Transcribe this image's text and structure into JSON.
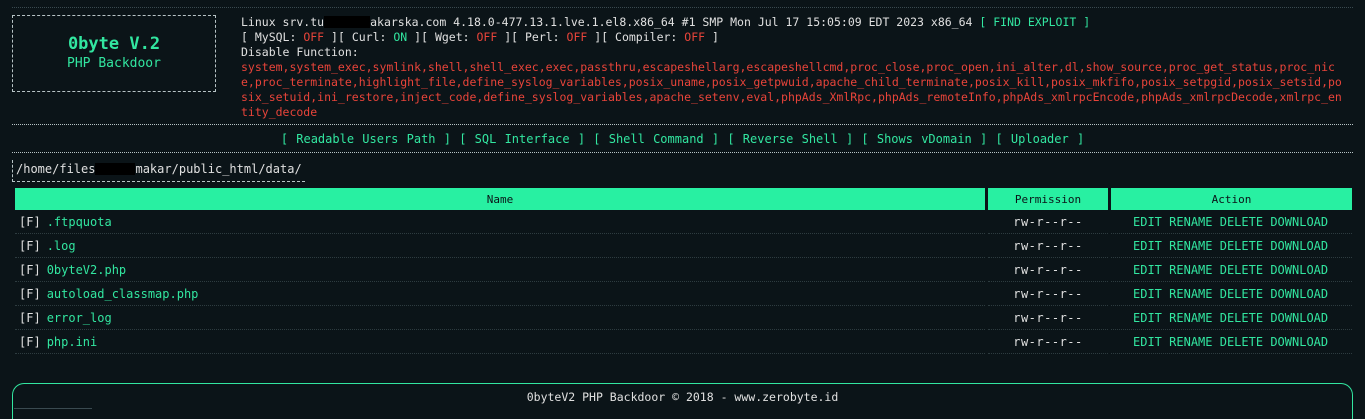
{
  "logo": {
    "title": "0byte V.2",
    "subtitle": "PHP Backdoor"
  },
  "system": {
    "uname_prefix": "Linux srv.tu",
    "uname_suffix": "akarska.com 4.18.0-477.13.1.lve.1.el8.x86_64 #1 SMP Mon Jul 17 15:05:09 EDT 2023 x86_64",
    "find_exploit": "[ FIND EXPLOIT ]"
  },
  "features": {
    "mysql_label": "[ MySQL:",
    "mysql_value": "OFF",
    "curl_label": "][ Curl:",
    "curl_value": "ON",
    "wget_label": "][ Wget:",
    "wget_value": "OFF",
    "perl_label": "][ Perl:",
    "perl_value": "OFF",
    "compiler_label": "][ Compiler:",
    "compiler_value": "OFF",
    "close": "]"
  },
  "disable_function": {
    "label": "Disable Function:",
    "list": "system,system_exec,symlink,shell,shell_exec,exec,passthru,escapeshellarg,escapeshellcmd,proc_close,proc_open,ini_alter,dl,show_source,proc_get_status,proc_nice,proc_terminate,highlight_file,define_syslog_variables,posix_uname,posix_getpwuid,apache_child_terminate,posix_kill,posix_mkfifo,posix_setpgid,posix_setsid,posix_setuid,ini_restore,inject_code,define_syslog_variables,apache_setenv,eval,phpAds_XmlRpc,phpAds_remoteInfo,phpAds_xmlrpcEncode,phpAds_xmlrpcDecode,xmlrpc_entity_decode"
  },
  "nav": {
    "readable_users_path": "[ Readable Users Path ]",
    "sql_interface": "[ SQL Interface ]",
    "shell_command": "[ Shell Command ]",
    "reverse_shell": "[ Reverse Shell ]",
    "shows_vdomain": "[ Shows vDomain ]",
    "uploader": "[ Uploader ]"
  },
  "path": {
    "seg1": "/home/",
    "seg2": "files",
    "seg3": "makar/",
    "seg4": "public_html/",
    "seg5": "data/"
  },
  "table": {
    "headers": {
      "name": "Name",
      "permission": "Permission",
      "action": "Action"
    },
    "rows": [
      {
        "type": "[F]",
        "name": ".ftpquota",
        "perm": "rw-r--r--"
      },
      {
        "type": "[F]",
        "name": ".log",
        "perm": "rw-r--r--"
      },
      {
        "type": "[F]",
        "name": "0byteV2.php",
        "perm": "rw-r--r--"
      },
      {
        "type": "[F]",
        "name": "autoload_classmap.php",
        "perm": "rw-r--r--"
      },
      {
        "type": "[F]",
        "name": "error_log",
        "perm": "rw-r--r--"
      },
      {
        "type": "[F]",
        "name": "php.ini",
        "perm": "rw-r--r--"
      }
    ],
    "actions": {
      "edit": "EDIT",
      "rename": "RENAME",
      "delete": "DELETE",
      "download": "DOWNLOAD"
    }
  },
  "footer": {
    "text": "0byteV2 PHP Backdoor © 2018 - www.zerobyte.id"
  },
  "colors": {
    "accent": "#32e6a0",
    "header_bg": "#28f0a2",
    "off": "#e8443a",
    "background": "#0b1418"
  }
}
